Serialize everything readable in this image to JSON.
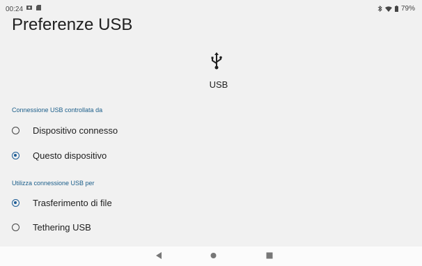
{
  "status": {
    "time": "00:24",
    "battery": "79%",
    "icons": [
      "photo-notification-icon",
      "sd-card-icon",
      "bluetooth-icon",
      "wifi-icon",
      "battery-icon"
    ]
  },
  "page": {
    "title": "Preferenze USB"
  },
  "usb": {
    "label": "USB",
    "icon": "usb-icon"
  },
  "sections": [
    {
      "title": "Connessione USB controllata da",
      "options": [
        {
          "label": "Dispositivo connesso",
          "checked": false
        },
        {
          "label": "Questo dispositivo",
          "checked": true
        }
      ]
    },
    {
      "title": "Utilizza connessione USB per",
      "options": [
        {
          "label": "Trasferimento di file",
          "checked": true
        },
        {
          "label": "Tethering USB",
          "checked": false
        }
      ]
    }
  ],
  "navigation": {
    "buttons": [
      "back-icon",
      "home-icon",
      "recents-icon"
    ]
  },
  "colors": {
    "background": "#f1f1f1",
    "accent": "#1d5d96",
    "section_title": "#1b5e8a",
    "navbar": "#fbfbfb"
  }
}
